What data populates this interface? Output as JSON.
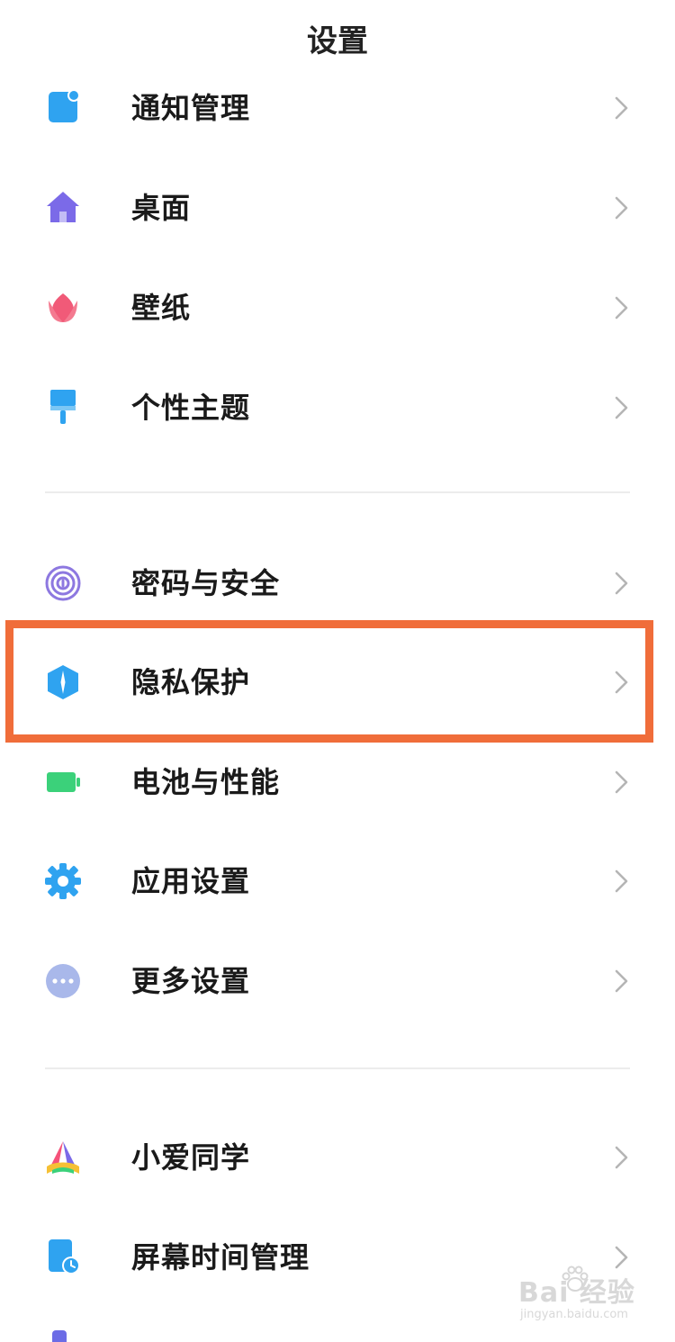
{
  "header": {
    "title": "设置"
  },
  "items": [
    {
      "label": "通知管理",
      "icon": "notification-icon"
    },
    {
      "label": "桌面",
      "icon": "home-icon"
    },
    {
      "label": "壁纸",
      "icon": "tulip-icon"
    },
    {
      "label": "个性主题",
      "icon": "paintbrush-icon"
    },
    {
      "label": "密码与安全",
      "icon": "fingerprint-icon"
    },
    {
      "label": "隐私保护",
      "icon": "privacy-shield-icon"
    },
    {
      "label": "电池与性能",
      "icon": "battery-icon"
    },
    {
      "label": "应用设置",
      "icon": "gear-icon"
    },
    {
      "label": "更多设置",
      "icon": "more-dots-icon"
    },
    {
      "label": "小爱同学",
      "icon": "xiaoai-icon"
    },
    {
      "label": "屏幕时间管理",
      "icon": "screen-time-icon"
    }
  ],
  "watermark": {
    "brand": "Bai 经验",
    "url": "jingyan.baidu.com"
  },
  "colors": {
    "highlight": "#f06d3a",
    "accent_blue": "#2fa3f0"
  }
}
